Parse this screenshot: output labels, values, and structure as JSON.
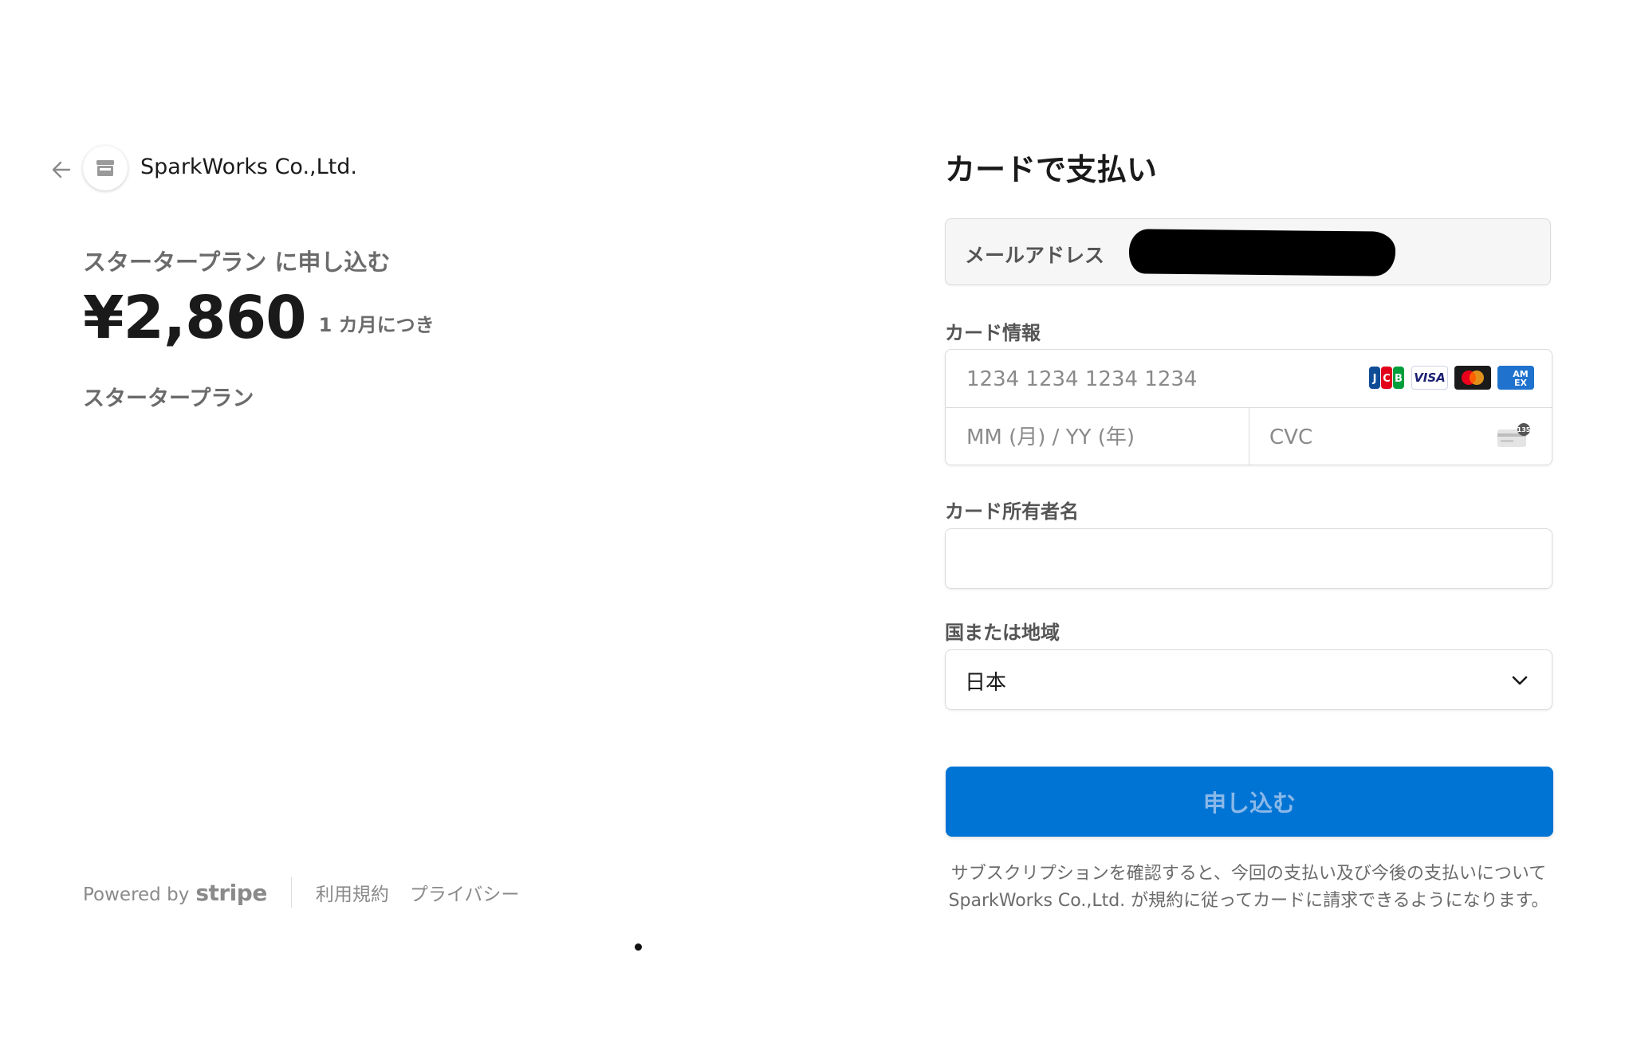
{
  "merchant": {
    "name": "SparkWorks Co.,Ltd."
  },
  "summary": {
    "plan_heading": "スタータープラン に申し込む",
    "price": "¥2,860",
    "period": "1 カ月につき",
    "plan_item": "スタータープラン"
  },
  "footer": {
    "powered_by": "Powered by",
    "brand": "stripe",
    "terms_link": "利用規約",
    "privacy_link": "プライバシー"
  },
  "payment": {
    "title": "カードで支払い",
    "email_label": "メールアドレス",
    "card_label": "カード情報",
    "card_number_placeholder": "1234 1234 1234 1234",
    "expiry_placeholder": "MM (月) / YY (年)",
    "cvc_placeholder": "CVC",
    "card_brands": [
      "JCB",
      "VISA",
      "Mastercard",
      "AMEX"
    ],
    "cvc_icon_text": "135",
    "holder_label": "カード所有者名",
    "holder_value": "",
    "country_label": "国または地域",
    "country_value": "日本",
    "submit_label": "申し込む",
    "terms_text": "サブスクリプションを確認すると、今回の支払い及び今後の支払いについて SparkWorks Co.,Ltd. が規約に従ってカードに請求できるようになります。"
  },
  "colors": {
    "primary_button": "#0074d4",
    "button_text": "#8ab8e8",
    "muted_text": "#6b6b6b",
    "field_border": "#dcdcdc"
  }
}
